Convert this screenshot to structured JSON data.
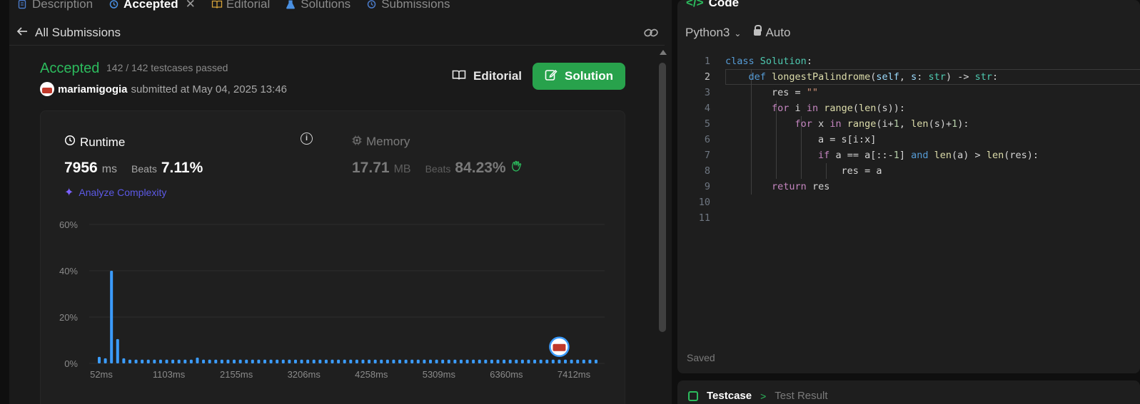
{
  "tabs": [
    {
      "label": "Description",
      "icon": "description-icon"
    },
    {
      "label": "Accepted",
      "icon": "history-icon",
      "active": true
    },
    {
      "label": "Editorial",
      "icon": "book-icon"
    },
    {
      "label": "Solutions",
      "icon": "flask-icon"
    },
    {
      "label": "Submissions",
      "icon": "history-icon"
    }
  ],
  "subbar": {
    "back_label": "All Submissions"
  },
  "submission": {
    "status": "Accepted",
    "testcases": "142 / 142 testcases passed",
    "username": "mariamigogia",
    "submitted": "submitted at May 04, 2025 13:46",
    "editorial_label": "Editorial",
    "solution_label": "Solution"
  },
  "runtime": {
    "label": "Runtime",
    "value": "7956",
    "unit": "ms",
    "beats_label": "Beats",
    "beats": "7.11%",
    "analyze_label": "Analyze Complexity"
  },
  "memory": {
    "label": "Memory",
    "value": "17.71",
    "unit": "MB",
    "beats_label": "Beats",
    "beats": "84.23%"
  },
  "chart_data": {
    "type": "bar",
    "x_tick_labels": [
      "52ms",
      "1103ms",
      "2155ms",
      "3206ms",
      "4258ms",
      "5309ms",
      "6360ms",
      "7412ms"
    ],
    "y_tick_labels": [
      "0%",
      "20%",
      "40%",
      "60%"
    ],
    "ylim": [
      0,
      60
    ],
    "values": [
      2.8,
      2.2,
      40,
      10.5,
      2.2,
      1.6,
      1.6,
      1.6,
      1.6,
      1.6,
      1.6,
      1.6,
      1.6,
      1.6,
      1.6,
      1.6,
      2.5,
      1.6,
      1.6,
      1.6,
      1.6,
      1.6,
      1.6,
      1.6,
      1.6,
      1.6,
      1.6,
      1.6,
      1.6,
      1.6,
      1.6,
      1.6,
      1.6,
      1.6,
      1.6,
      1.6,
      1.6,
      1.6,
      1.6,
      1.6,
      1.6,
      1.6,
      1.6,
      1.6,
      1.6,
      1.6,
      1.6,
      1.6,
      1.6,
      1.6,
      1.6,
      1.6,
      1.6,
      1.6,
      1.6,
      1.6,
      1.6,
      1.6,
      1.6,
      1.6,
      1.6,
      1.6,
      1.6,
      1.6,
      1.6,
      1.6,
      1.6,
      1.6,
      1.6,
      1.6,
      1.6,
      1.6,
      1.6,
      1.6,
      1.6,
      1.6,
      1.6,
      1.6,
      1.6,
      1.6,
      1.6,
      1.6
    ],
    "highlight_index": 75,
    "bar_color": "#3b9cff",
    "grid": true
  },
  "code_panel": {
    "title": "Code",
    "language": "Python3",
    "mode": "Auto",
    "saved": "Saved",
    "line_numbers": [
      "1",
      "2",
      "3",
      "4",
      "5",
      "6",
      "7",
      "8",
      "9",
      "10",
      "11"
    ]
  },
  "test_panel": {
    "tab1": "Testcase",
    "tab2": "Test Result"
  },
  "colors": {
    "accent_green": "#2cbb5d",
    "button_green": "#28a24c",
    "bar_blue": "#3b9cff"
  }
}
